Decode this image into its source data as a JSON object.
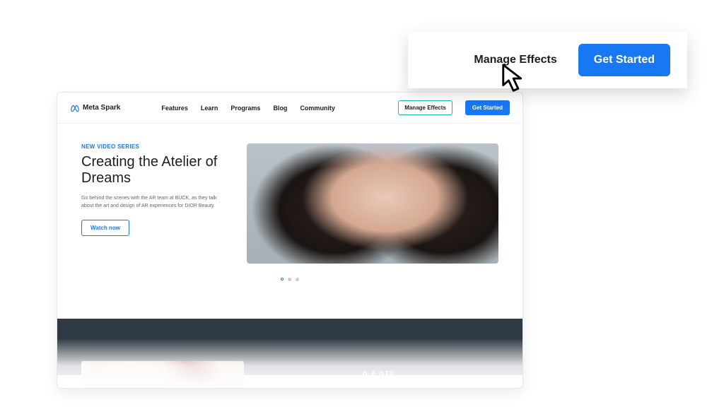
{
  "brand": {
    "name": "Meta Spark",
    "logo_color": "#1877f2"
  },
  "nav": {
    "items": [
      "Features",
      "Learn",
      "Programs",
      "Blog",
      "Community"
    ],
    "manage_label": "Manage Effects",
    "cta_label": "Get Started"
  },
  "hero": {
    "eyebrow": "NEW VIDEO SERIES",
    "title": "Creating the Atelier of Dreams",
    "description": "Go behind the scenes with the AR team at BUCK, as they talk about the art and design of AR experiences for DIOR Beauty.",
    "watch_label": "Watch now"
  },
  "carousel": {
    "count": 3,
    "active_index": 0
  },
  "band_heading_peek": "A                         f AR",
  "callout": {
    "manage_label": "Manage Effects",
    "cta_label": "Get Started"
  },
  "colors": {
    "primary": "#1877f2",
    "outline": "#14b8a6",
    "dark_band": "#2f3a44"
  }
}
